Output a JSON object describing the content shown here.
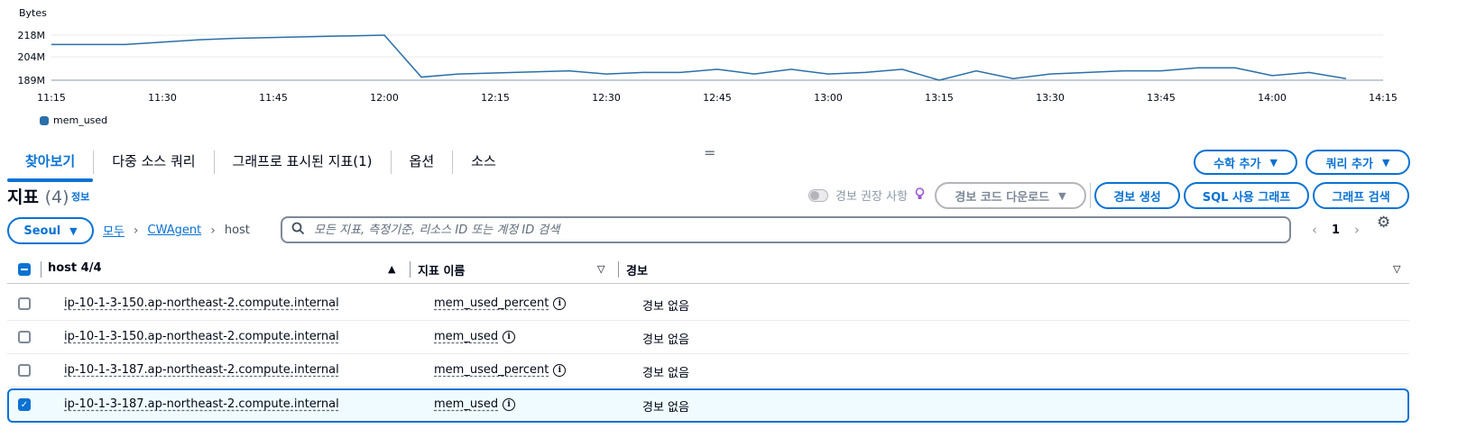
{
  "chart_data": {
    "type": "line",
    "ylabel": "Bytes",
    "yticks": [
      "218M",
      "204M",
      "189M"
    ],
    "ylim": [
      189,
      218
    ],
    "xticks": [
      "11:15",
      "11:30",
      "11:45",
      "12:00",
      "12:15",
      "12:30",
      "12:45",
      "13:00",
      "13:15",
      "13:30",
      "13:45",
      "14:00",
      "14:15"
    ],
    "xlim": [
      "11:15",
      "14:15"
    ],
    "grid": true,
    "legend_position": "bottom-left",
    "series": [
      {
        "name": "mem_used",
        "color": "#2a6fa8",
        "x": [
          "11:15",
          "11:25",
          "11:35",
          "11:40",
          "12:00",
          "12:05",
          "12:10",
          "12:25",
          "12:30",
          "12:35",
          "12:40",
          "12:45",
          "12:50",
          "12:55",
          "13:00",
          "13:05",
          "13:10",
          "13:15",
          "13:20",
          "13:25",
          "13:30",
          "13:35",
          "13:40",
          "13:45",
          "13:50",
          "13:55",
          "14:00",
          "14:05",
          "14:10"
        ],
        "values": [
          212,
          212,
          215,
          216,
          218,
          191,
          193,
          195,
          193,
          194,
          194,
          196,
          193,
          196,
          193,
          194,
          196,
          189,
          195,
          190,
          193,
          194,
          195,
          195,
          197,
          197,
          192,
          194,
          190
        ]
      }
    ]
  },
  "tabs": [
    "찾아보기",
    "다중 소스 쿼리",
    "그래프로 표시된 지표(1)",
    "옵션",
    "소스"
  ],
  "drag_handle": "=",
  "buttons": {
    "add_math": "수학 추가",
    "add_query": "쿼리 추가",
    "alarm_code_download": "경보 코드 다운로드",
    "create_alarm": "경보 생성",
    "graph_with_sql": "SQL 사용 그래프",
    "graph_search": "그래프 검색"
  },
  "metrics_header": {
    "title": "지표",
    "count": "(4)",
    "info": "정보"
  },
  "alarm_recommendations": "경보 권장 사항",
  "region": "Seoul",
  "breadcrumb": {
    "all": "모두",
    "namespace": "CWAgent",
    "dimension": "host"
  },
  "search": {
    "placeholder": "모든 지표, 측정기준, 리소스 ID 또는 계정 ID 검색",
    "value": ""
  },
  "pagination": {
    "page": "1"
  },
  "table": {
    "columns": {
      "host": "host 4/4",
      "metric": "지표 이름",
      "alarm": "경보"
    },
    "rows": [
      {
        "host": "ip-10-1-3-150.ap-northeast-2.compute.internal",
        "metric": "mem_used_percent",
        "alarm": "경보 없음",
        "checked": false
      },
      {
        "host": "ip-10-1-3-150.ap-northeast-2.compute.internal",
        "metric": "mem_used",
        "alarm": "경보 없음",
        "checked": false
      },
      {
        "host": "ip-10-1-3-187.ap-northeast-2.compute.internal",
        "metric": "mem_used_percent",
        "alarm": "경보 없음",
        "checked": false
      },
      {
        "host": "ip-10-1-3-187.ap-northeast-2.compute.internal",
        "metric": "mem_used",
        "alarm": "경보 없음",
        "checked": true
      }
    ]
  },
  "colors": {
    "accent": "#0972d3",
    "series": "#2a6fa8"
  }
}
